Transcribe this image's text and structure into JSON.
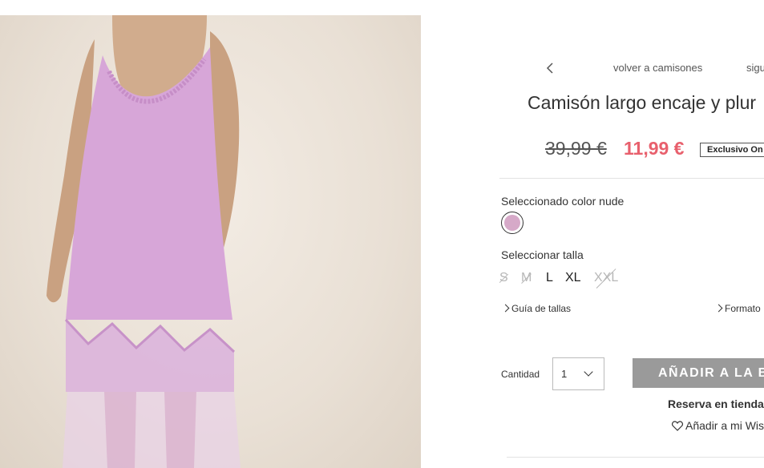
{
  "nav": {
    "back_icon": "chevron-left-icon",
    "back_label": "volver a camisones",
    "next_label": "sigu"
  },
  "product": {
    "title": "Camisón largo encaje y plur",
    "old_price": "39,99 €",
    "new_price": "11,99 €",
    "badge": "Exclusivo On",
    "price_color": "#e8606d"
  },
  "color": {
    "label": "Seleccionado color nude",
    "swatch_color": "#d6a9c8"
  },
  "size": {
    "label": "Seleccionar talla",
    "options": [
      {
        "label": "S",
        "available": false
      },
      {
        "label": "M",
        "available": false
      },
      {
        "label": "L",
        "available": true
      },
      {
        "label": "XL",
        "available": true
      },
      {
        "label": "XXL",
        "available": false
      }
    ]
  },
  "links": {
    "size_guide": "Guía de tallas",
    "format": "Formato"
  },
  "purchase": {
    "quantity_label": "Cantidad",
    "quantity_value": "1",
    "add_button": "AÑADIR A LA B",
    "reserve": "Reserva en tienda",
    "wishlist": "Añadir a mi Wis"
  },
  "colors": {
    "button_bg": "#9a9a9a",
    "garment": "#d7a6d8"
  }
}
